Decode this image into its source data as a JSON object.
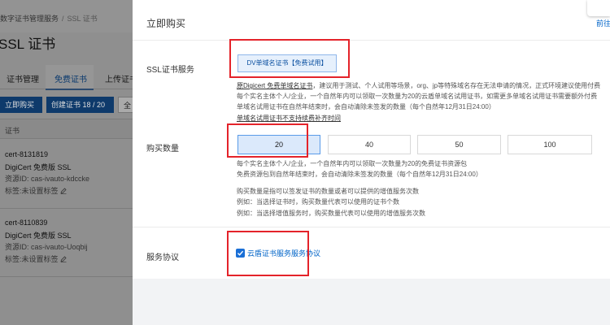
{
  "left": {
    "breadcrumb": [
      "数字证书管理服务",
      "SSL 证书"
    ],
    "title": "SSL 证书",
    "tabs": [
      "证书管理",
      "免费证书",
      "上传证书"
    ],
    "buttons": {
      "buy": "立即购买",
      "create": "创建证书 18 / 20",
      "all": "全"
    },
    "list_header": "证书",
    "certs": [
      {
        "id": "cert-8131819",
        "type": "DigiCert 免费版 SSL",
        "resource": "资源ID: cas-ivauto-kdccke",
        "tag": "标签:未设置标签"
      },
      {
        "id": "cert-8110839",
        "type": "DigiCert 免费版 SSL",
        "resource": "资源ID: cas-ivauto-Uoqbij",
        "tag": "标签:未设置标签"
      }
    ]
  },
  "main": {
    "title": "立即购买",
    "top_link": "前往",
    "ssl": {
      "label": "SSL证书服务",
      "product": "DV单域名证书【免费试用】",
      "desc1_u": "原Digicert 免费单域名证书",
      "desc1": "，建议用于测试、个人试用等场景，org、jp等特殊域名存在无法申请的情况，正式环境建议使用付费",
      "desc2": "每个实名主体个人/企业，一个自然年内可以领取一次数量为20的云盾单域名试用证书，如需更多单域名试用证书需要额外付费",
      "desc3": "单域名试用证书在自然年结束时，会自动清除未签发的数量（每个自然年12月31日24:00）",
      "desc4_u": "单域名试用证书不支持续费补齐时间"
    },
    "quantity": {
      "label": "购买数量",
      "options": [
        "20",
        "40",
        "50",
        "100"
      ],
      "selected": "20",
      "desc1": "每个实名主体个人/企业，一个自然年内可以领取一次数量为20的免费证书资源包",
      "desc2": "免费资源包到自然年结束时，会自动清除未签发的数量（每个自然年12月31日24:00）",
      "desc3": "购买数量是指可以签发证书的数量或者可以提供的增值服务次数",
      "desc4": "例如：当选择证书时，购买数量代表可以使用的证书个数",
      "desc5": "例如：当选择增值服务时，购买数量代表可以使用的增值服务次数"
    },
    "agreement": {
      "label": "服务协议",
      "checked": true,
      "text": "云盾证书服务服务协议"
    }
  },
  "colors": {
    "accent": "#0064c8",
    "highlight_red": "#e4232a",
    "selected_bg": "#dbe9fb"
  }
}
